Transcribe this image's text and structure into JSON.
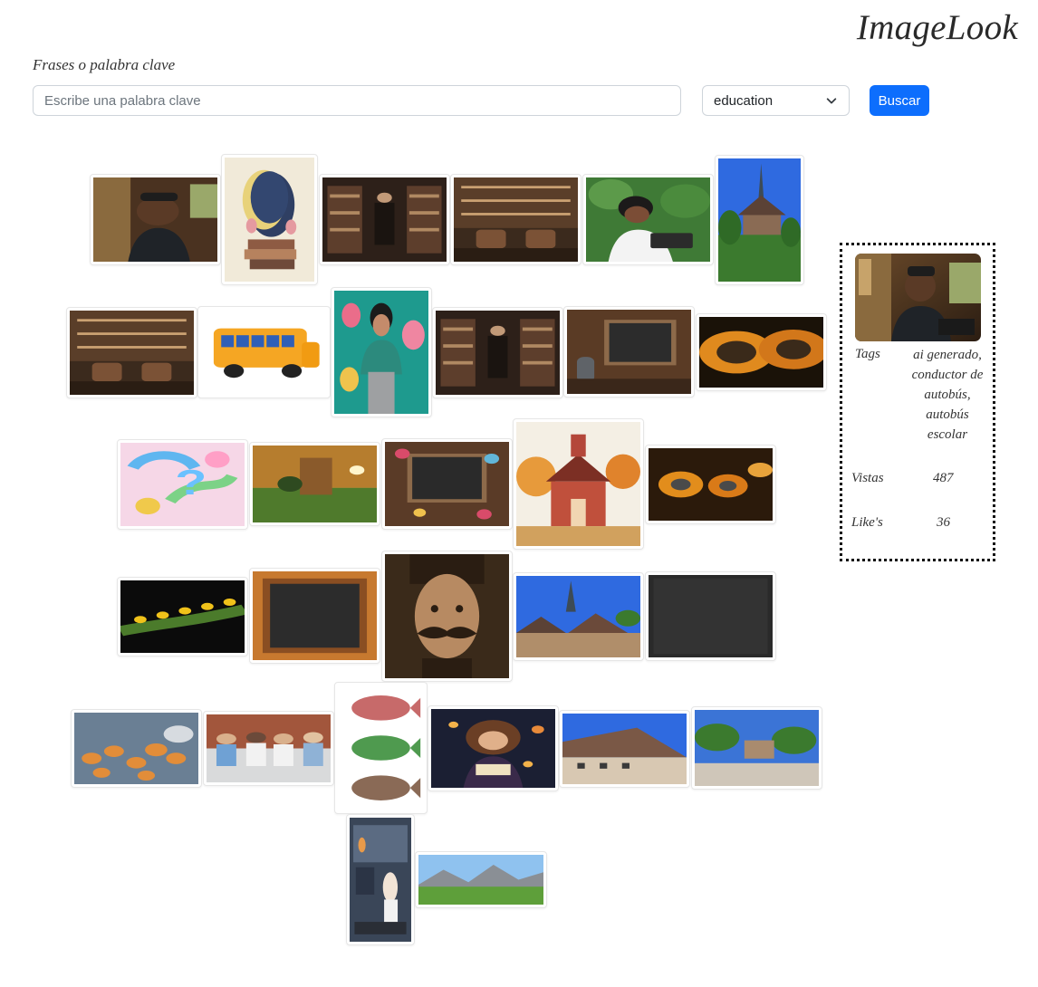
{
  "app": {
    "brand": "ImageLook"
  },
  "search": {
    "label": "Frases o palabra clave",
    "placeholder": "Escribe una palabra clave",
    "value": "",
    "category": "education",
    "button_label": "Buscar"
  },
  "colors": {
    "accent": "#0d6efd"
  },
  "gallery": [
    {
      "name": "thumb-bus-driver-portrait"
    },
    {
      "name": "thumb-moon-over-books"
    },
    {
      "name": "thumb-library-person"
    },
    {
      "name": "thumb-library-reading-room"
    },
    {
      "name": "thumb-woman-reading-garden"
    },
    {
      "name": "thumb-church-spire"
    },
    {
      "name": "thumb-library-study"
    },
    {
      "name": "thumb-school-bus"
    },
    {
      "name": "thumb-woman-floral-shirt"
    },
    {
      "name": "thumb-library-armchair"
    },
    {
      "name": "thumb-chalkboard-easel"
    },
    {
      "name": "thumb-sunflower-closeup"
    },
    {
      "name": "thumb-question-marks"
    },
    {
      "name": "thumb-book-landscape"
    },
    {
      "name": "thumb-chalkboard-hearts"
    },
    {
      "name": "thumb-red-schoolhouse"
    },
    {
      "name": "thumb-seed-pods"
    },
    {
      "name": "thumb-spore-branch"
    },
    {
      "name": "thumb-chalkboard-frame"
    },
    {
      "name": "thumb-mustache-man"
    },
    {
      "name": "thumb-village-spire"
    },
    {
      "name": "thumb-blank-chalkboard"
    },
    {
      "name": "thumb-fungi-macro"
    },
    {
      "name": "thumb-school-children"
    },
    {
      "name": "thumb-fish-illustration"
    },
    {
      "name": "thumb-girl-reading-night"
    },
    {
      "name": "thumb-rooftops-street"
    },
    {
      "name": "thumb-trees-square"
    },
    {
      "name": "thumb-anime-study-room"
    },
    {
      "name": "thumb-mountain-meadow"
    }
  ],
  "details": {
    "tags_label": "Tags",
    "tags_value": "ai generado, conductor de autobús, autobús escolar",
    "views_label": "Vistas",
    "views_value": "487",
    "likes_label": "Like's",
    "likes_value": "36"
  }
}
